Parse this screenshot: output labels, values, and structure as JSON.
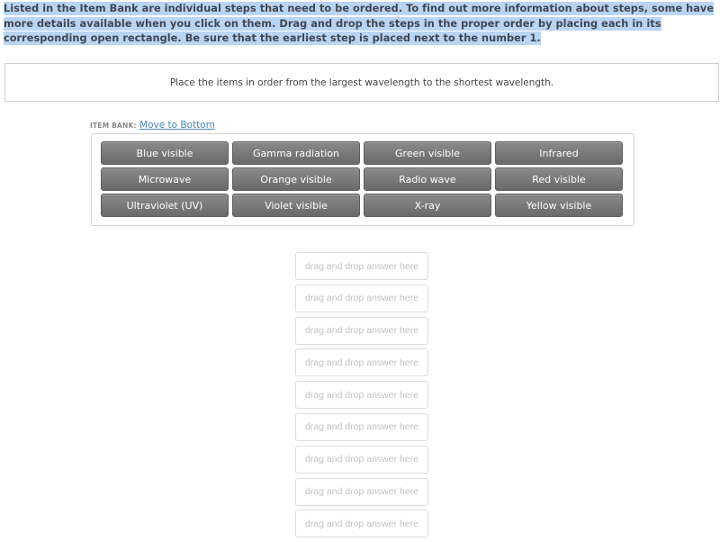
{
  "instructions": {
    "text": "Listed in the Item Bank are individual steps that need to be ordered. To find out more information about steps, some have more details available when you click on them. Drag and drop the steps in the proper order by placing each in its corresponding open rectangle. Be sure that the earliest step is placed next to the number 1.",
    "highlight_color": "#b9d5f2"
  },
  "prompt": {
    "text": "Place the items in order from the largest wavelength to the shortest wavelength."
  },
  "item_bank": {
    "label": "ITEM BANK:",
    "move_link": "Move to Bottom",
    "items": [
      {
        "label": "Blue visible"
      },
      {
        "label": "Gamma radiation"
      },
      {
        "label": "Green visible"
      },
      {
        "label": "Infrared"
      },
      {
        "label": "Microwave"
      },
      {
        "label": "Orange visible"
      },
      {
        "label": "Radio wave"
      },
      {
        "label": "Red visible"
      },
      {
        "label": "Ultraviolet (UV)"
      },
      {
        "label": "Violet visible"
      },
      {
        "label": "X-ray"
      },
      {
        "label": "Yellow visible"
      }
    ]
  },
  "drop_zones": [
    {
      "placeholder": "drag and drop answer here"
    },
    {
      "placeholder": "drag and drop answer here"
    },
    {
      "placeholder": "drag and drop answer here"
    },
    {
      "placeholder": "drag and drop answer here"
    },
    {
      "placeholder": "drag and drop answer here"
    },
    {
      "placeholder": "drag and drop answer here"
    },
    {
      "placeholder": "drag and drop answer here"
    },
    {
      "placeholder": "drag and drop answer here"
    },
    {
      "placeholder": "drag and drop answer here"
    }
  ],
  "colors": {
    "item_background": "#777777",
    "link": "#4a86b8",
    "drop_text": "#c2c2c2"
  }
}
